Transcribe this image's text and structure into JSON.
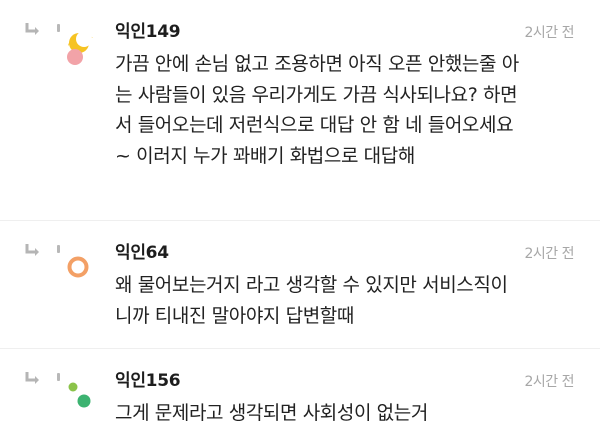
{
  "comments": [
    {
      "author": "익인149",
      "time": "2시간 전",
      "avatar_icon": "moon-blossom-avatar-icon",
      "lines": [
        "가끔 안에 손님 없고 조용하면 아직 오픈 안했는줄 아",
        "는 사람들이 있음 우리가게도 가끔 식사되나요? 하면",
        "서 들어오는데 저런식으로 대답 안 함 네 들어오세요",
        "~ 이러지 누가 꽈배기 화법으로 대답해"
      ]
    },
    {
      "author": "익인64",
      "time": "2시간 전",
      "avatar_icon": "orange-ring-avatar-icon",
      "lines": [
        "왜 물어보는거지 라고 생각할 수 있지만 서비스직이",
        "니까 티내진 말아야지 답변할때"
      ]
    },
    {
      "author": "익인156",
      "time": "2시간 전",
      "avatar_icon": "green-dots-avatar-icon",
      "lines": [
        "그게 문제라고 생각되면 사회성이 없는거"
      ]
    }
  ],
  "colors": {
    "author": "#1d1d1d",
    "time": "#a7a7a7",
    "body": "#222222",
    "reply_icon": "#b5b5b5"
  }
}
